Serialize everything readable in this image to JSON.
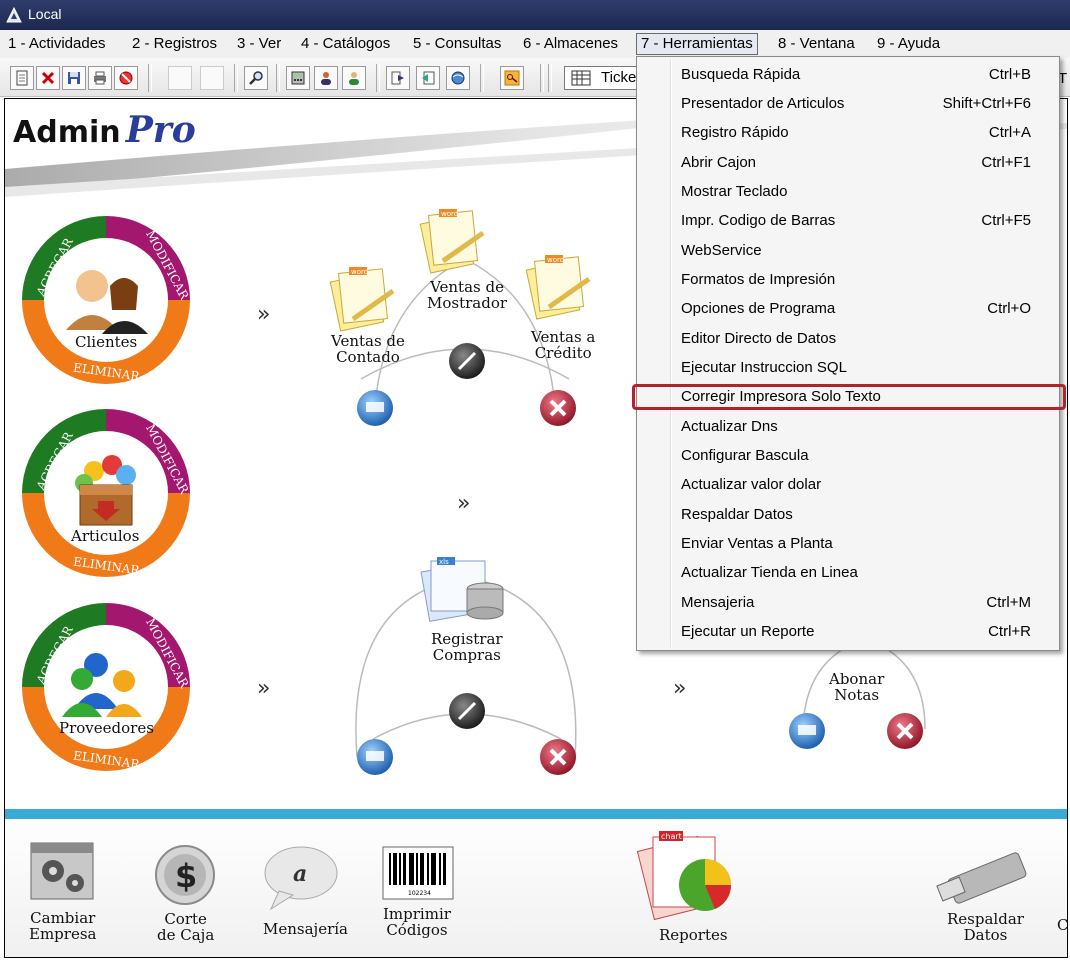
{
  "window": {
    "title": "Local"
  },
  "menubar": [
    "1 - Actividades",
    "2 - Registros",
    "3 - Ver",
    "4 - Catálogos",
    "5 - Consultas",
    "6 - Almacenes",
    "7 - Herramientas",
    "8 - Ventana",
    "9 - Ayuda"
  ],
  "toolbar": {
    "combo_text": "Ticke",
    "trailing_text": "T"
  },
  "logo": {
    "admin": "Admin",
    "pro": "Pro"
  },
  "dropdown": {
    "items": [
      {
        "label": "Busqueda Rápida",
        "shortcut": "Ctrl+B"
      },
      {
        "label": "Presentador de Articulos",
        "shortcut": "Shift+Ctrl+F6"
      },
      {
        "label": "Registro Rápido",
        "shortcut": "Ctrl+A"
      },
      {
        "label": "Abrir Cajon",
        "shortcut": "Ctrl+F1"
      },
      {
        "label": "Mostrar Teclado",
        "shortcut": ""
      },
      {
        "label": "Impr. Codigo de Barras",
        "shortcut": "Ctrl+F5"
      },
      {
        "label": "WebService",
        "shortcut": ""
      },
      {
        "label": "Formatos de Impresión",
        "shortcut": ""
      },
      {
        "label": "Opciones de Programa",
        "shortcut": "Ctrl+O"
      },
      {
        "label": "Editor Directo de Datos",
        "shortcut": ""
      },
      {
        "label": "Ejecutar Instruccion SQL",
        "shortcut": ""
      },
      {
        "label": "Corregir Impresora Solo Texto",
        "shortcut": ""
      },
      {
        "label": "Actualizar Dns",
        "shortcut": ""
      },
      {
        "label": "Configurar Bascula",
        "shortcut": ""
      },
      {
        "label": "Actualizar valor dolar",
        "shortcut": ""
      },
      {
        "label": "Respaldar Datos",
        "shortcut": ""
      },
      {
        "label": "Enviar Ventas a Planta",
        "shortcut": ""
      },
      {
        "label": "Actualizar Tienda en Linea",
        "shortcut": ""
      },
      {
        "label": "Mensajeria",
        "shortcut": "Ctrl+M"
      },
      {
        "label": "Ejecutar un Reporte",
        "shortcut": "Ctrl+R"
      }
    ]
  },
  "rings": {
    "agregar": "AGREGAR",
    "modificar": "MODIFICAR",
    "eliminar": "ELIMINAR",
    "clientes": "Clientes",
    "articulos": "Articulos",
    "proveedores": "Proveedores"
  },
  "flow": {
    "ventas_contado_1": "Ventas de",
    "ventas_contado_2": "Contado",
    "ventas_mostrador_1": "Ventas de",
    "ventas_mostrador_2": "Mostrador",
    "ventas_credito_1": "Ventas a",
    "ventas_credito_2": "Crédito",
    "registrar_compras_1": "Registrar",
    "registrar_compras_2": "Compras",
    "abonar_notas_1": "Abonar",
    "abonar_notas_2": "Notas",
    "chevron": "»",
    "doc_word": "word",
    "doc_xls": "xls",
    "doc_chart": "chart"
  },
  "bottom": {
    "cambiar_1": "Cambiar",
    "cambiar_2": "Empresa",
    "corte_1": "Corte",
    "corte_2": "de Caja",
    "mensajeria": "Mensajería",
    "imprimir_1": "Imprimir",
    "imprimir_2": "Códigos",
    "reportes": "Reportes",
    "respaldar_1": "Respaldar",
    "respaldar_2": "Datos",
    "trailing": "C",
    "barcode_number": "102234"
  },
  "colors": {
    "ring_green": "#1f7a24",
    "ring_purple": "#a3186e",
    "ring_orange": "#f07a18",
    "highlight": "#b3212a",
    "accent_bar": "#3aaad6"
  }
}
